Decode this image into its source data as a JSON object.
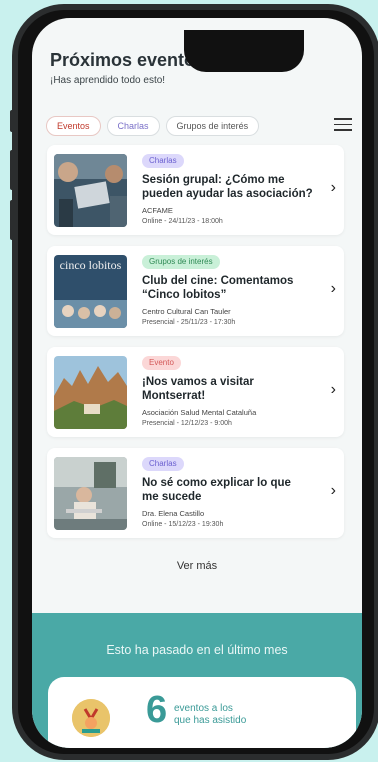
{
  "header": {
    "title": "Próximos eventos",
    "subtitle": "¡Has aprendido todo esto!"
  },
  "filters": [
    {
      "label": "Eventos"
    },
    {
      "label": "Charlas"
    },
    {
      "label": "Grupos de interés"
    }
  ],
  "events": [
    {
      "tag": "Charlas",
      "title": "Sesión grupal: ¿Cómo me pueden ayudar las asociación?",
      "org": "ACFAME",
      "date": "Online - 24/11/23 - 18:00h"
    },
    {
      "tag": "Grupos de interés",
      "title": "Club del cine: Comentamos “Cinco lobitos”",
      "org": "Centro Cultural Can Tauler",
      "date": "Presencial - 25/11/23 - 17:30h",
      "poster_text": "cinco lobitos"
    },
    {
      "tag": "Evento",
      "title": "¡Nos vamos a visitar Montserrat!",
      "org": "Asociación Salud Mental Cataluña",
      "date": "Presencial - 12/12/23 - 9:00h"
    },
    {
      "tag": "Charlas",
      "title": "No sé como explicar lo que me sucede",
      "org": "Dra. Elena Castillo",
      "date": "Online - 15/12/23 - 19:30h"
    }
  ],
  "more_label": "Ver más",
  "summary": {
    "heading": "Esto ha pasado en el último mes",
    "count": "6",
    "count_label_1": "eventos a los",
    "count_label_2": "que has asistido"
  },
  "colors": {
    "accent": "#4aa9a6",
    "background": "#c9f1ee"
  },
  "icons": {
    "menu": "hamburger-menu-icon",
    "chevron": "chevron-right-icon"
  }
}
